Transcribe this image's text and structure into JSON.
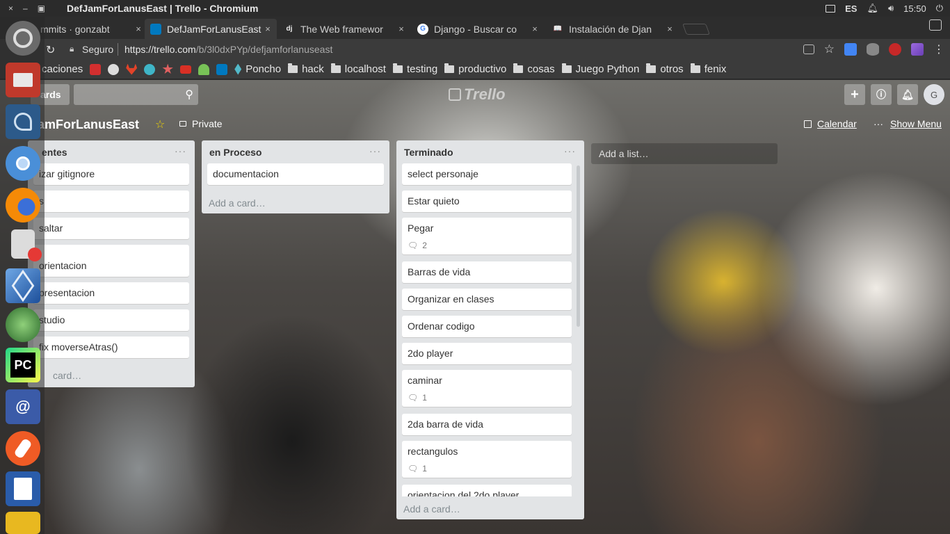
{
  "system": {
    "window_title": "DefJamForLanusEast | Trello - Chromium",
    "window_controls": [
      "×",
      "–",
      "▣"
    ],
    "keyboard": "ES",
    "time": "15:50"
  },
  "tabs": [
    {
      "label": "mmits · gonzabt",
      "icon": "github-icon",
      "color": "#333333"
    },
    {
      "label": "DefJamForLanusEast",
      "icon": "trello-icon",
      "color": "#0079bf",
      "active": true
    },
    {
      "label": "The Web framewor",
      "icon": "django-icon",
      "color": "#0c4b33",
      "glyph": "dj"
    },
    {
      "label": "Django - Buscar co",
      "icon": "google-icon",
      "color": "#4285f4",
      "glyph": "G"
    },
    {
      "label": "Instalación de Djan",
      "icon": "book-icon",
      "color": "#555555",
      "glyph": "📖"
    }
  ],
  "tab_close": "×",
  "address": {
    "secure_label": "Seguro",
    "url_host": "https://trello.com",
    "url_path": "/b/3l0dxPYp/defjamforlanuseast"
  },
  "bookmarks": [
    {
      "label": "caciones",
      "type": "link"
    },
    {
      "label": "",
      "type": "favicon",
      "icon": "youtube-icon",
      "color": "#d32f2f"
    },
    {
      "label": "",
      "type": "favicon",
      "icon": "github-icon",
      "color": "#dddddd"
    },
    {
      "label": "",
      "type": "favicon",
      "icon": "gitlab-icon",
      "color": "#e24329"
    },
    {
      "label": "",
      "type": "favicon",
      "icon": "python-icon",
      "color": "#3fb5c7"
    },
    {
      "label": "",
      "type": "favicon",
      "icon": "star-icon",
      "color": "#e06060"
    },
    {
      "label": "",
      "type": "favicon",
      "icon": "gmail-icon",
      "color": "#d93025"
    },
    {
      "label": "",
      "type": "favicon",
      "icon": "android-icon",
      "color": "#78c257"
    },
    {
      "label": "",
      "type": "favicon",
      "icon": "trello-icon",
      "color": "#0079bf"
    },
    {
      "label": "Poncho",
      "type": "link",
      "icon": "poncho-icon",
      "color": "#52b9c9"
    },
    {
      "label": "hack",
      "type": "folder"
    },
    {
      "label": "localhost",
      "type": "folder"
    },
    {
      "label": "testing",
      "type": "folder"
    },
    {
      "label": "productivo",
      "type": "folder"
    },
    {
      "label": "cosas",
      "type": "folder"
    },
    {
      "label": "Juego Python",
      "type": "folder"
    },
    {
      "label": "otros",
      "type": "folder"
    },
    {
      "label": "fenix",
      "type": "folder"
    }
  ],
  "trello": {
    "boards_label": "ards",
    "logo": "Trello",
    "avatar_initial": "G",
    "board_name": "JamForLanusEast",
    "visibility": "Private",
    "calendar_label": "Calendar",
    "menu_label": "Show Menu",
    "add_list": "Add a list…",
    "add_card": "Add a card…",
    "lists": [
      {
        "title": "entes",
        "cards": [
          {
            "text": "izar gitignore"
          },
          {
            "text": "s"
          },
          {
            "text": "saltar"
          },
          {
            "text": "orientacion"
          },
          {
            "text": "presentacion"
          },
          {
            "text": "studio"
          },
          {
            "text": "fix moverseAtras()"
          }
        ],
        "add_card": "card…"
      },
      {
        "title": "en Proceso",
        "cards": [
          {
            "text": "documentacion"
          }
        ],
        "add_card": "Add a card…"
      },
      {
        "title": "Terminado",
        "cards": [
          {
            "text": "select personaje"
          },
          {
            "text": "Estar quieto"
          },
          {
            "text": "Pegar",
            "comments": "2"
          },
          {
            "text": "Barras de vida"
          },
          {
            "text": "Organizar en clases"
          },
          {
            "text": "Ordenar codigo"
          },
          {
            "text": "2do player"
          },
          {
            "text": "caminar",
            "comments": "1"
          },
          {
            "text": "2da barra de vida"
          },
          {
            "text": "rectangulos",
            "comments": "1"
          },
          {
            "text": "orientacion del 2do player"
          }
        ],
        "add_card": "Add a card…"
      }
    ]
  },
  "launcher": [
    {
      "name": "ubuntu-dash-icon",
      "color": "#5a5a5a"
    },
    {
      "name": "files-icon",
      "color": "#c0392b"
    },
    {
      "name": "mysql-workbench-icon",
      "color": "#2c5a8a"
    },
    {
      "name": "chromium-icon",
      "color": "#4a8fd8"
    },
    {
      "name": "firefox-icon",
      "color": "#e66000"
    },
    {
      "name": "text-editor-icon",
      "color": "#dddddd"
    },
    {
      "name": "virtualbox-icon",
      "color": "#2c6ab0"
    },
    {
      "name": "globe-app-icon",
      "color": "#3a8a3a"
    },
    {
      "name": "pycharm-icon",
      "color": "#1a1a1a",
      "glyph": "PC"
    },
    {
      "name": "mail-icon",
      "color": "#3b5ba8",
      "glyph": "@"
    },
    {
      "name": "postman-icon",
      "color": "#ef5b25"
    },
    {
      "name": "writer-icon",
      "color": "#2a5caa"
    },
    {
      "name": "notes-icon",
      "color": "#e8b820"
    }
  ]
}
